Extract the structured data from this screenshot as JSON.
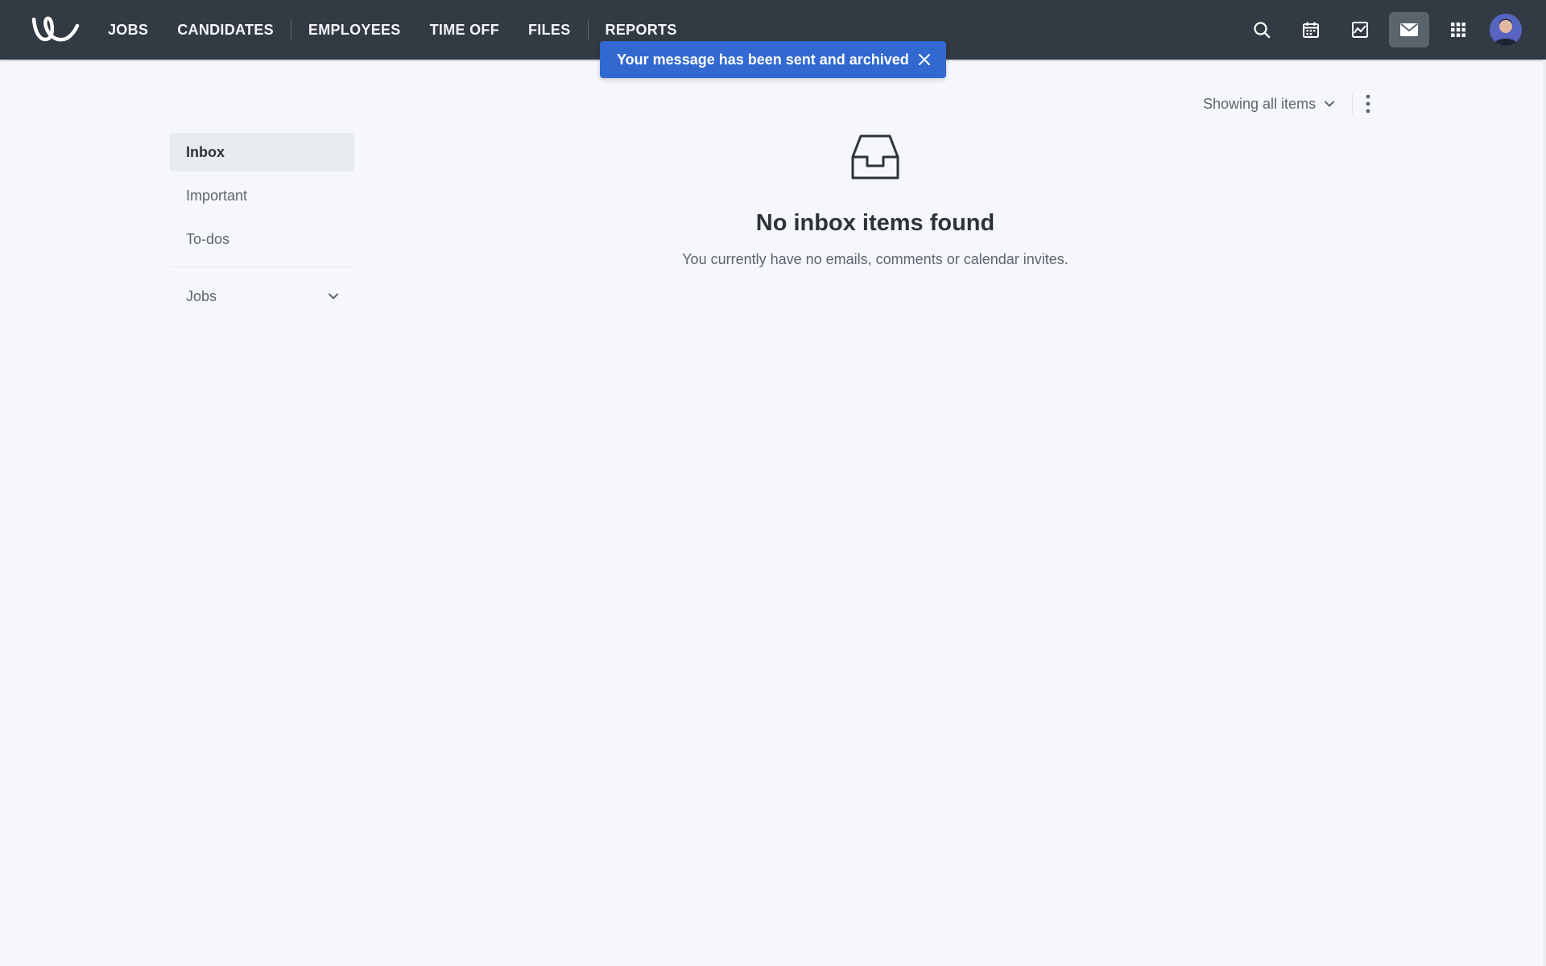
{
  "nav": {
    "items": [
      {
        "label": "JOBS"
      },
      {
        "label": "CANDIDATES"
      },
      {
        "label": "EMPLOYEES"
      },
      {
        "label": "TIME OFF"
      },
      {
        "label": "FILES"
      },
      {
        "label": "REPORTS"
      }
    ],
    "icons": [
      "search-icon",
      "calendar-icon",
      "activity-icon",
      "mail-icon",
      "apps-grid-icon"
    ],
    "active_icon": "mail-icon"
  },
  "toast": {
    "message": "Your message has been sent and archived",
    "color": "#3269d1"
  },
  "sidebar": {
    "items": [
      {
        "label": "Inbox",
        "active": true
      },
      {
        "label": "Important",
        "active": false
      },
      {
        "label": "To-dos",
        "active": false
      }
    ],
    "group": {
      "label": "Jobs"
    }
  },
  "filter": {
    "label": "Showing all items"
  },
  "empty_state": {
    "icon": "inbox-tray-icon",
    "title": "No inbox items found",
    "subtitle": "You currently have no emails, comments or calendar invites."
  },
  "colors": {
    "topbar": "#323a44",
    "background": "#f5f7fa"
  }
}
